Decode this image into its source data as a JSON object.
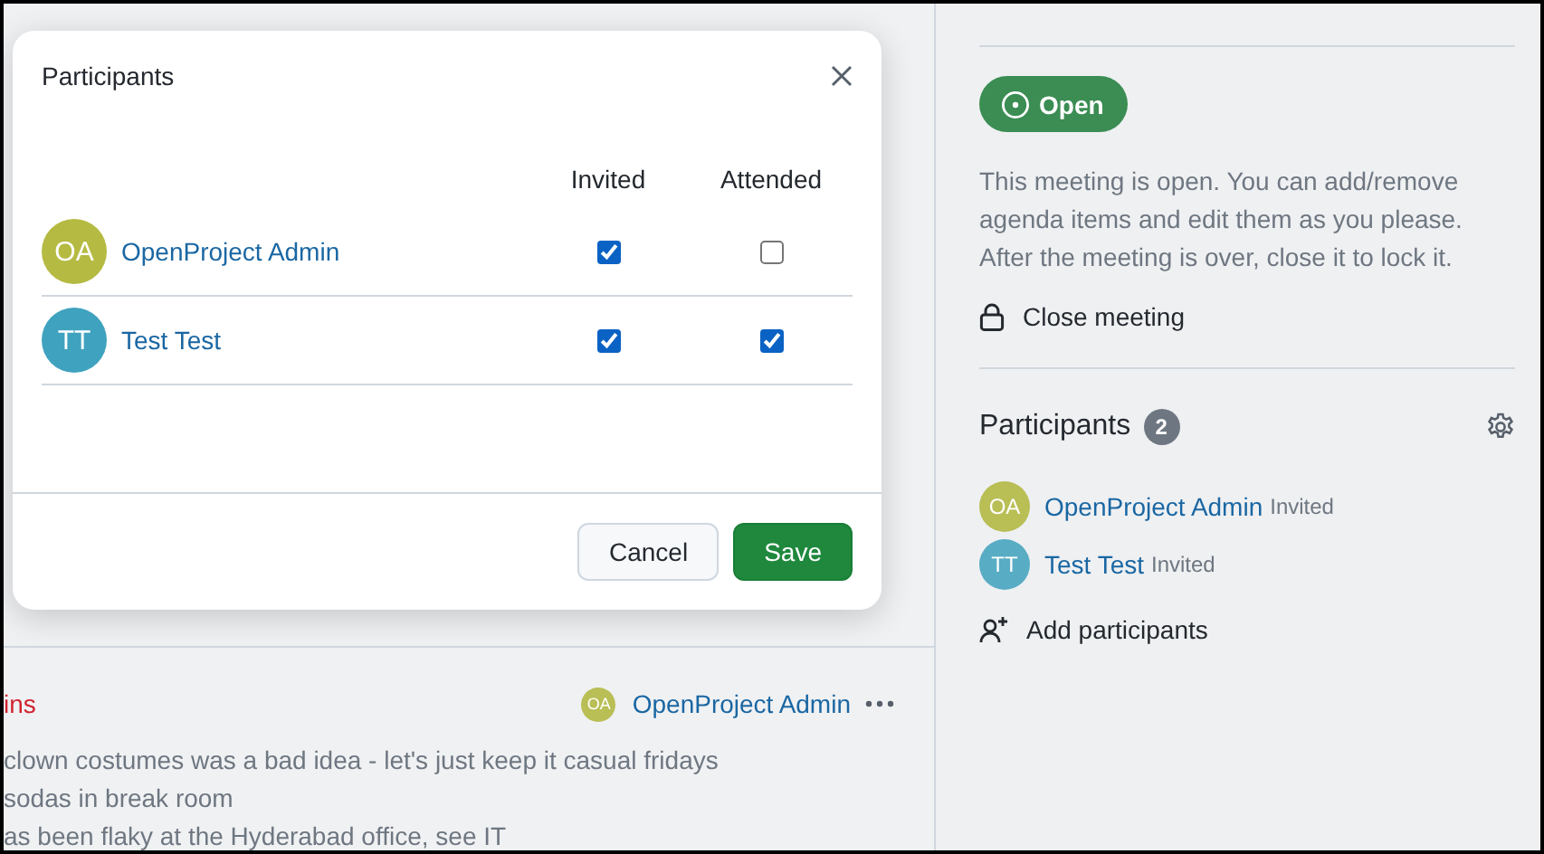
{
  "agenda_item": {
    "title": "ins",
    "author": {
      "initials": "OA",
      "name": "OpenProject Admin",
      "color": "#b9be55"
    },
    "lines": [
      "clown costumes was a bad idea - let's just keep it casual fridays",
      "sodas in break room",
      "as been flaky at the Hyderabad office, see IT"
    ]
  },
  "sidebar": {
    "status": {
      "label": "Open"
    },
    "description": "This meeting is open. You can add/remove agenda items and edit them as you please. After the meeting is over, close it to lock it.",
    "close_action": "Close meeting",
    "participants": {
      "title": "Participants",
      "count": "2",
      "items": [
        {
          "initials": "OA",
          "name": "OpenProject Admin",
          "status": "Invited",
          "color": "#b9be55"
        },
        {
          "initials": "TT",
          "name": "Test Test",
          "status": "Invited",
          "color": "#58acc4"
        }
      ],
      "add_action": "Add participants"
    }
  },
  "dialog": {
    "title": "Participants",
    "columns": [
      "Invited",
      "Attended"
    ],
    "participants": [
      {
        "initials": "OA",
        "name": "OpenProject Admin",
        "color": "#b5ba42",
        "invited": true,
        "attended": false
      },
      {
        "initials": "TT",
        "name": "Test Test",
        "color": "#3fa2bf",
        "invited": true,
        "attended": true
      }
    ],
    "buttons": [
      {
        "label": "Cancel",
        "kind": "secondary"
      },
      {
        "label": "Save",
        "kind": "primary"
      }
    ]
  }
}
